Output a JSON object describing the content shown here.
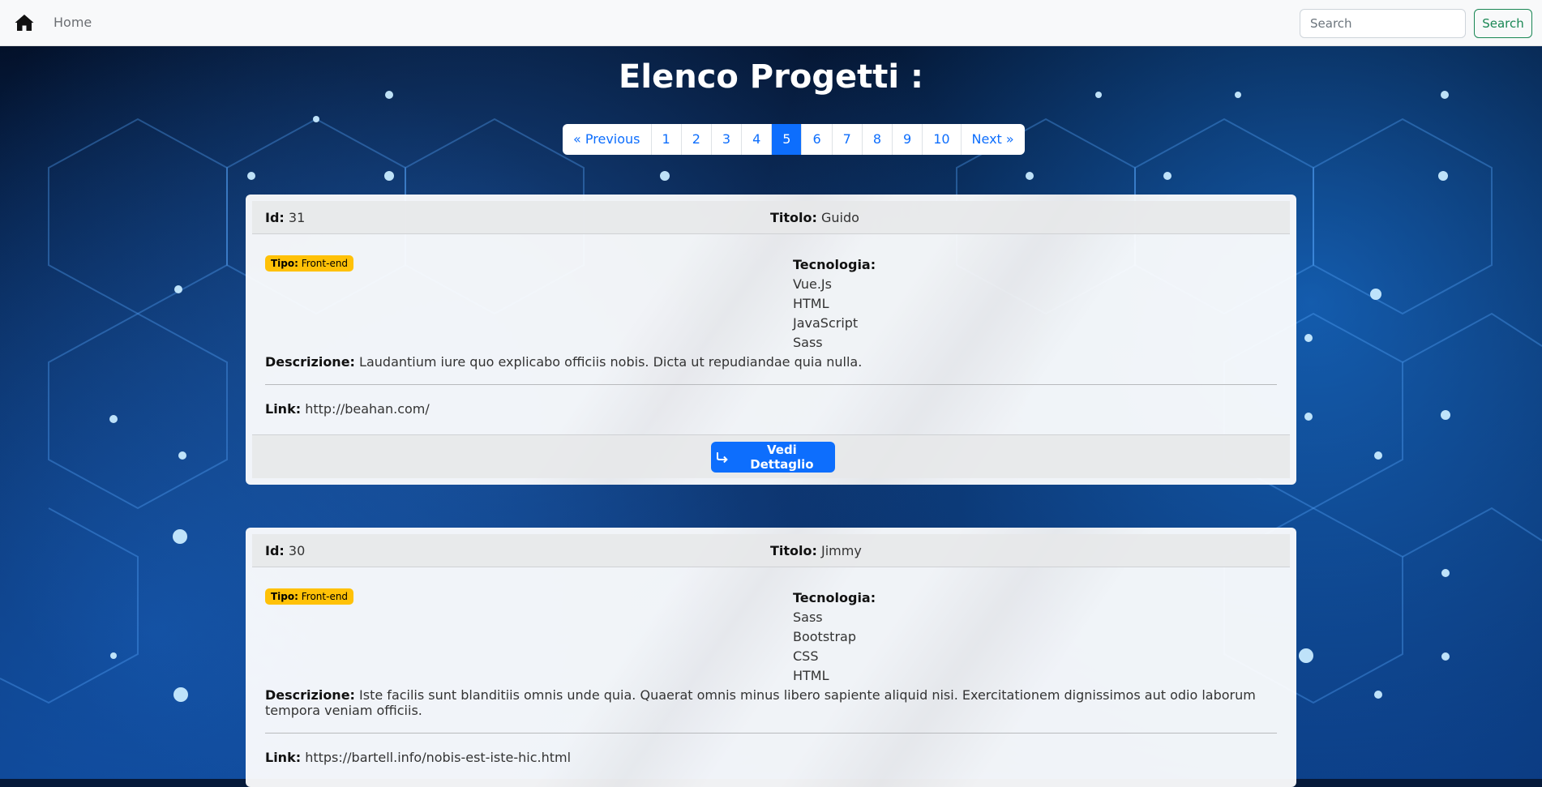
{
  "navbar": {
    "home_label": "Home",
    "search_placeholder": "Search",
    "search_button": "Search"
  },
  "page_title": "Elenco Progetti :",
  "pagination": {
    "previous": "« Previous",
    "pages": [
      "1",
      "2",
      "3",
      "4",
      "5",
      "6",
      "7",
      "8",
      "9",
      "10"
    ],
    "active": "5",
    "next": "Next »"
  },
  "labels": {
    "id": "Id:",
    "titolo": "Titolo:",
    "tipo": "Tipo:",
    "tecnologia": "Tecnologia:",
    "descrizione": "Descrizione:",
    "link": "Link:",
    "detail_button": "Vedi Dettaglio"
  },
  "projects": [
    {
      "id": "31",
      "titolo": "Guido",
      "tipo": "Front-end",
      "tecnologie": [
        "Vue.Js",
        "HTML",
        "JavaScript",
        "Sass"
      ],
      "descrizione": "Laudantium iure quo explicabo officiis nobis. Dicta ut repudiandae quia nulla.",
      "link": "http://beahan.com/"
    },
    {
      "id": "30",
      "titolo": "Jimmy",
      "tipo": "Front-end",
      "tecnologie": [
        "Sass",
        "Bootstrap",
        "CSS",
        "HTML"
      ],
      "descrizione": "Iste facilis sunt blanditiis omnis unde quia. Quaerat omnis minus libero sapiente aliquid nisi. Exercitationem dignissimos aut odio laborum tempora veniam officiis.",
      "link": "https://bartell.info/nobis-est-iste-hic.html"
    }
  ],
  "colors": {
    "primary": "#0d6efd",
    "success": "#198754",
    "warning": "#ffc107",
    "background": "#061a3a"
  }
}
